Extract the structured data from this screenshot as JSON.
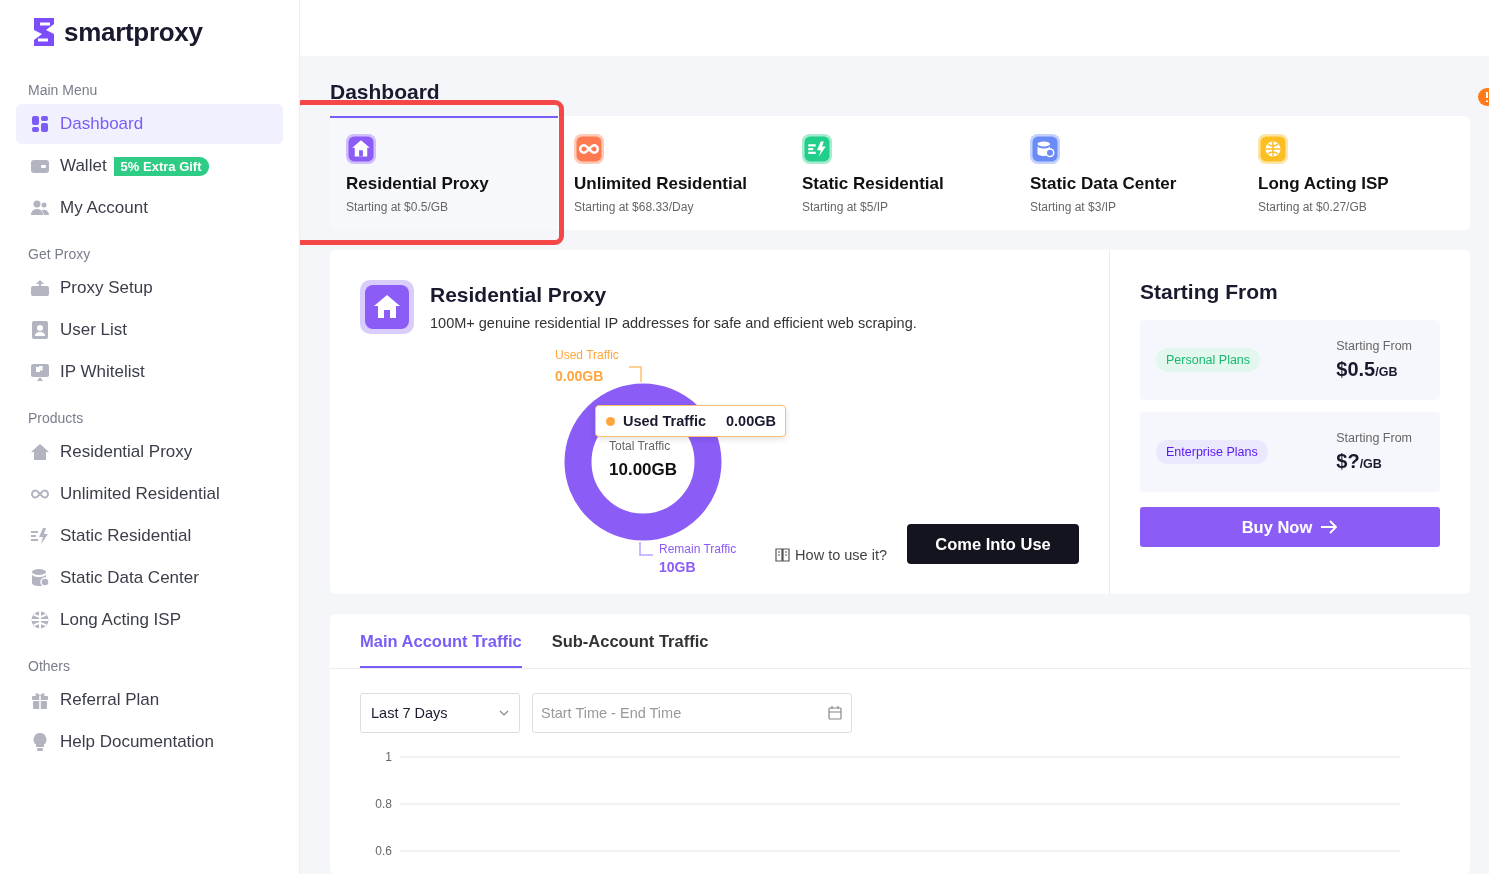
{
  "logo": {
    "text": "smartproxy"
  },
  "sidebar": {
    "sections": [
      {
        "title": "Main Menu",
        "items": [
          {
            "label": "Dashboard",
            "selected": true
          },
          {
            "label": "Wallet",
            "badge": "5% Extra Gift",
            "selected": false
          },
          {
            "label": "My Account",
            "selected": false
          }
        ]
      },
      {
        "title": "Get Proxy",
        "items": [
          {
            "label": "Proxy Setup",
            "selected": false
          },
          {
            "label": "User List",
            "selected": false
          },
          {
            "label": "IP Whitelist",
            "selected": false
          }
        ]
      },
      {
        "title": "Products",
        "items": [
          {
            "label": "Residential Proxy",
            "selected": false
          },
          {
            "label": "Unlimited Residential",
            "selected": false
          },
          {
            "label": "Static Residential",
            "selected": false
          },
          {
            "label": "Static Data Center",
            "selected": false
          },
          {
            "label": "Long Acting ISP",
            "selected": false
          }
        ]
      },
      {
        "title": "Others",
        "items": [
          {
            "label": "Referral Plan",
            "selected": false
          },
          {
            "label": "Help Documentation",
            "selected": false
          }
        ]
      }
    ]
  },
  "page_title": "Dashboard",
  "product_tabs": [
    {
      "name": "Residential Proxy",
      "price": "Starting at $0.5/GB",
      "color": "#8b5cf6",
      "selected": true
    },
    {
      "name": "Unlimited Residential",
      "price": "Starting at $68.33/Day",
      "color": "#ff7a50",
      "selected": false
    },
    {
      "name": "Static Residential",
      "price": "Starting at $5/IP",
      "color": "#22cf8a",
      "selected": false
    },
    {
      "name": "Static Data Center",
      "price": "Starting at $3/IP",
      "color": "#6b8cf7",
      "selected": false
    },
    {
      "name": "Long Acting ISP",
      "price": "Starting at $0.27/GB",
      "color": "#fbbf24",
      "selected": false
    }
  ],
  "product": {
    "title": "Residential Proxy",
    "description": "100M+ genuine residential IP addresses for safe and efficient web scraping.",
    "traffic": {
      "used_label": "Used Traffic",
      "used_value": "0.00GB",
      "remain_label": "Remain Traffic",
      "remain_value": "10GB",
      "total_label": "Total Traffic",
      "total_value": "10.00GB",
      "tooltip": {
        "label": "Used Traffic",
        "value": "0.00GB"
      }
    },
    "help_link": "How to use it?",
    "action_button": "Come Into Use"
  },
  "pricing": {
    "title": "Starting From",
    "plans": [
      {
        "kind": "personal",
        "tag": "Personal Plans",
        "label": "Starting From",
        "price": "$0.5",
        "unit": "/GB"
      },
      {
        "kind": "enterprise",
        "tag": "Enterprise Plans",
        "label": "Starting From",
        "price": "$?",
        "unit": "/GB"
      }
    ],
    "buy_button": "Buy Now"
  },
  "traffic_tabs": [
    {
      "label": "Main Account Traffic",
      "selected": true
    },
    {
      "label": "Sub-Account Traffic",
      "selected": false
    }
  ],
  "filters": {
    "range": {
      "value": "Last 7 Days"
    },
    "date_range": {
      "placeholder": "Start Time - End Time"
    }
  },
  "traffic_chart": {
    "y_ticks": [
      "1",
      "0.8",
      "0.6"
    ]
  }
}
